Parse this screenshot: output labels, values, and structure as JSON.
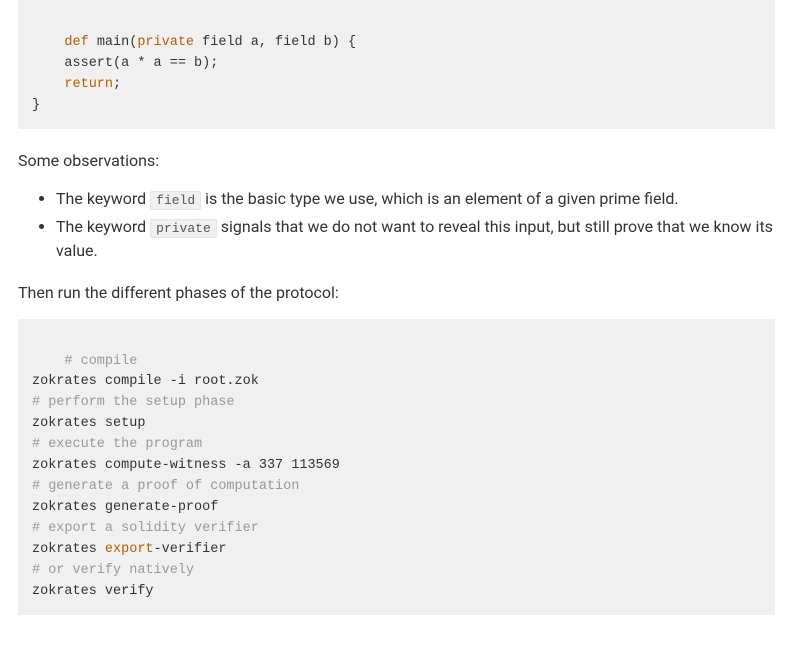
{
  "code1": {
    "line1_def": "def",
    "line1_main": " main(",
    "line1_private": "private",
    "line1_rest": " field a, field b) {",
    "line2_indent": "    assert(a * a == b);",
    "line3_indent": "    ",
    "line3_return": "return",
    "line3_semi": ";",
    "line4": "}"
  },
  "para1": "Some observations:",
  "obs": {
    "item1_a": "The keyword ",
    "item1_code": "field",
    "item1_b": " is the basic type we use, which is an element of a given prime field.",
    "item2_a": "The keyword ",
    "item2_code": "private",
    "item2_b": " signals that we do not want to reveal this input, but still prove that we know its value."
  },
  "para2": "Then run the different phases of the protocol:",
  "code2": {
    "c1": "# compile",
    "l2": "zokrates compile -i root.zok",
    "c3": "# perform the setup phase",
    "l4": "zokrates setup",
    "c5": "# execute the program",
    "l6": "zokrates compute-witness -a 337 113569",
    "c7": "# generate a proof of computation",
    "l8": "zokrates generate-proof",
    "c9": "# export a solidity verifier",
    "l10a": "zokrates ",
    "l10b": "export",
    "l10c": "-verifier",
    "c11": "# or verify natively",
    "l12": "zokrates verify"
  }
}
